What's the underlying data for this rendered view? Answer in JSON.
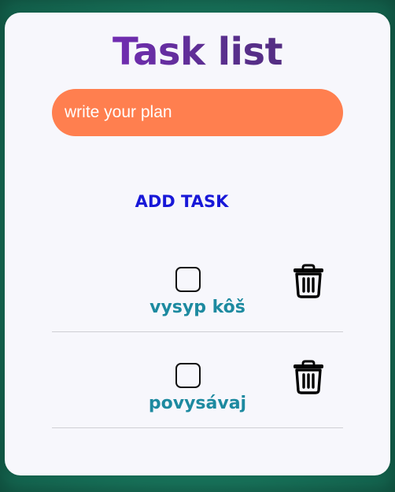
{
  "app": {
    "title": "Task list"
  },
  "input": {
    "placeholder": "write your plan",
    "value": ""
  },
  "actions": {
    "add_label": "ADD TASK"
  },
  "tasks": [
    {
      "text": "vysyp kôš",
      "done": false,
      "delete_icon": "trash-icon"
    },
    {
      "text": "povysávaj",
      "done": false,
      "delete_icon": "trash-icon"
    }
  ],
  "colors": {
    "background": "#1b7f64",
    "card": "#f7f7fc",
    "title_gradient_start": "#8a2ad6",
    "title_gradient_end": "#4a2d6e",
    "input_fill": "#ff7f4f",
    "add_button_text": "#1818d8",
    "task_text": "#1d8aa0"
  }
}
